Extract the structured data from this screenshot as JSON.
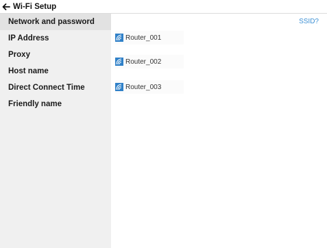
{
  "window": {
    "title": "Wi-Fi Setup"
  },
  "sidebar": {
    "items": [
      {
        "label": "Network and password",
        "selected": true
      },
      {
        "label": "IP Address"
      },
      {
        "label": "Proxy"
      },
      {
        "label": "Host name"
      },
      {
        "label": "Direct Connect Time"
      },
      {
        "label": "Friendly name"
      }
    ]
  },
  "main": {
    "ssid_link": "SSID?",
    "networks": [
      {
        "name": "Router_001",
        "icon": "wifi-icon"
      },
      {
        "name": "Router_002",
        "icon": "wifi-icon"
      },
      {
        "name": "Router_003",
        "icon": "wifi-icon"
      }
    ]
  },
  "colors": {
    "link": "#3b8fd4",
    "sidebar_bg": "#f0f0f0",
    "selected_bg": "#e2e2e2",
    "wifi_icon": "#2f80c8"
  }
}
